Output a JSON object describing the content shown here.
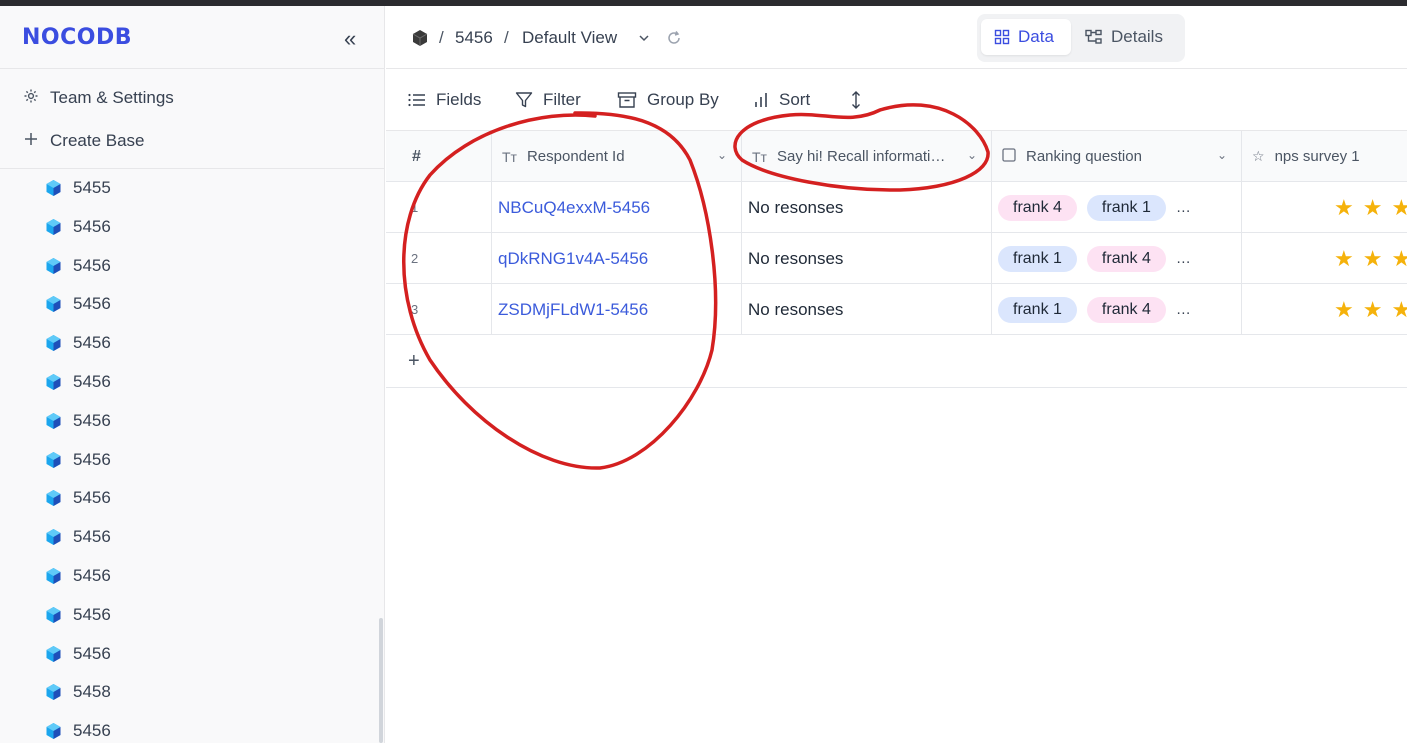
{
  "app": {
    "logo": "NOCODB",
    "collapse_glyph": "«"
  },
  "sidebar": {
    "team_settings": "Team & Settings",
    "create_base": "Create Base",
    "bases": [
      "5455",
      "5456",
      "5456",
      "5456",
      "5456",
      "5456",
      "5456",
      "5456",
      "5456",
      "5456",
      "5456",
      "5456",
      "5456",
      "5458",
      "5456"
    ]
  },
  "header": {
    "sep1": "/",
    "base_name": "5456",
    "sep2": "/",
    "view_name": "Default View",
    "tabs": {
      "data": "Data",
      "details": "Details"
    }
  },
  "toolbar": {
    "fields": "Fields",
    "filter": "Filter",
    "group_by": "Group By",
    "sort": "Sort"
  },
  "grid": {
    "columns": {
      "row_num": "#",
      "respondent": "Respondent Id",
      "say_hi": "Say hi! Recall informati…",
      "ranking": "Ranking question",
      "nps": "nps survey 1"
    },
    "rows": [
      {
        "num": "1",
        "respondent": "NBCuQ4exxM-5456",
        "say_hi": "No resonses",
        "ranking": [
          "frank 4",
          "frank 1"
        ],
        "ranking_more": "…"
      },
      {
        "num": "2",
        "respondent": "qDkRNG1v4A-5456",
        "say_hi": "No resonses",
        "ranking": [
          "frank 1",
          "frank 4"
        ],
        "ranking_more": "…"
      },
      {
        "num": "3",
        "respondent": "ZSDMjFLdW1-5456",
        "say_hi": "No resonses",
        "ranking": [
          "frank 1",
          "frank 4"
        ],
        "ranking_more": "…"
      }
    ],
    "add_row": "+"
  },
  "colors": {
    "brand": "#3b4de0",
    "star": "#f5b20b",
    "annotation": "#d42020"
  }
}
